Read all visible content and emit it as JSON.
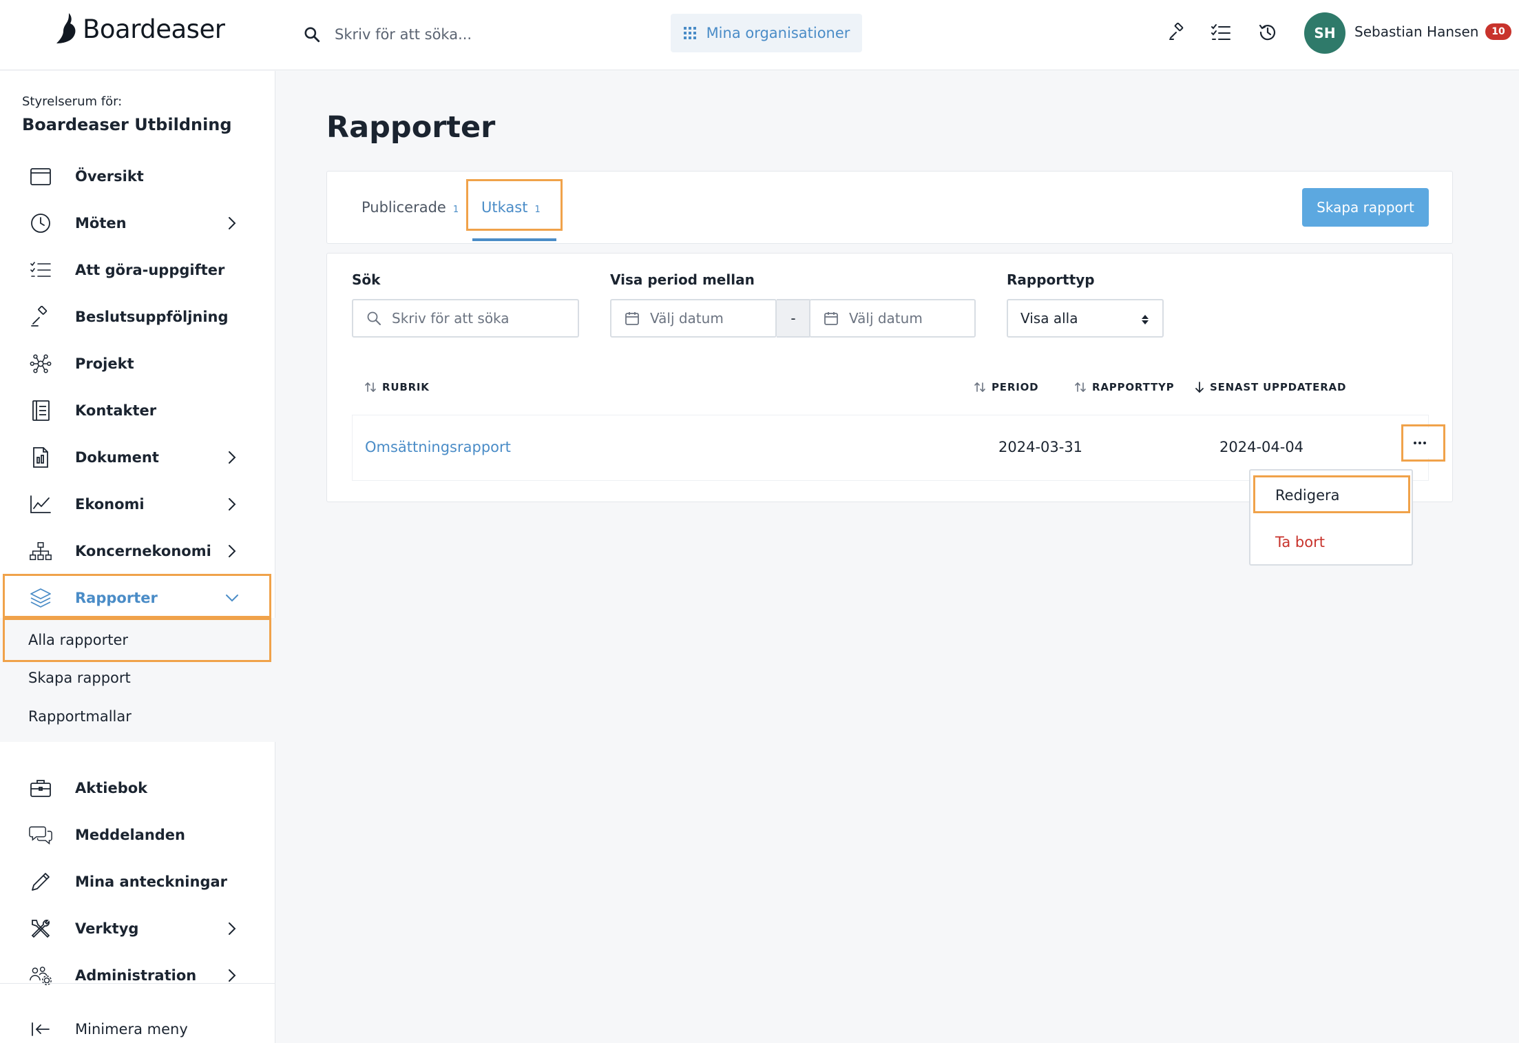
{
  "header": {
    "brand": "Boardeaser",
    "search_placeholder": "Skriv för att söka...",
    "org_button": "Mina organisationer",
    "user_initials": "SH",
    "user_name": "Sebastian Hansen",
    "notification_count": "10"
  },
  "sidebar": {
    "caption": "Styrelserum för:",
    "org_name": "Boardeaser Utbildning",
    "items": [
      {
        "label": "Översikt",
        "icon": "calendar-icon"
      },
      {
        "label": "Möten",
        "icon": "clock-icon"
      },
      {
        "label": "Att göra-uppgifter",
        "icon": "checklist-icon"
      },
      {
        "label": "Beslutsuppföljning",
        "icon": "gavel-icon"
      },
      {
        "label": "Projekt",
        "icon": "network-icon"
      },
      {
        "label": "Kontakter",
        "icon": "address-book-icon"
      },
      {
        "label": "Dokument",
        "icon": "document-icon"
      },
      {
        "label": "Ekonomi",
        "icon": "line-chart-icon"
      },
      {
        "label": "Koncernekonomi",
        "icon": "org-chart-icon"
      },
      {
        "label": "Rapporter",
        "icon": "layers-icon"
      }
    ],
    "submenu": [
      "Alla rapporter",
      "Skapa rapport",
      "Rapportmallar"
    ],
    "items_after": [
      {
        "label": "Aktiebok",
        "icon": "briefcase-icon"
      },
      {
        "label": "Meddelanden",
        "icon": "chat-icon"
      },
      {
        "label": "Mina anteckningar",
        "icon": "pencil-icon"
      },
      {
        "label": "Verktyg",
        "icon": "tools-icon"
      },
      {
        "label": "Administration",
        "icon": "users-gear-icon"
      }
    ],
    "collapse_label": "Minimera meny"
  },
  "main": {
    "title": "Rapporter",
    "tabs": [
      {
        "label": "Publicerade",
        "count": "1"
      },
      {
        "label": "Utkast",
        "count": "1"
      }
    ],
    "create_button": "Skapa rapport",
    "filters": {
      "search_label": "Sök",
      "search_placeholder": "Skriv för att söka",
      "period_label": "Visa period mellan",
      "date_from_placeholder": "Välj datum",
      "date_separator": "-",
      "date_to_placeholder": "Välj datum",
      "type_label": "Rapporttyp",
      "type_value": "Visa alla"
    },
    "table": {
      "columns": [
        "RUBRIK",
        "PERIOD",
        "RAPPORTTYP",
        "SENAST UPPDATERAD"
      ],
      "rows": [
        {
          "title": "Omsättningsrapport",
          "period": "2024-03-31",
          "type": "",
          "updated": "2024-04-04"
        }
      ]
    },
    "row_menu": {
      "edit": "Redigera",
      "delete": "Ta bort"
    }
  },
  "colors": {
    "accent": "#4a8cc7",
    "primary_button": "#5ca8e0",
    "danger": "#c8332c",
    "avatar": "#2f7a6a",
    "highlight": "#f0a24a"
  }
}
